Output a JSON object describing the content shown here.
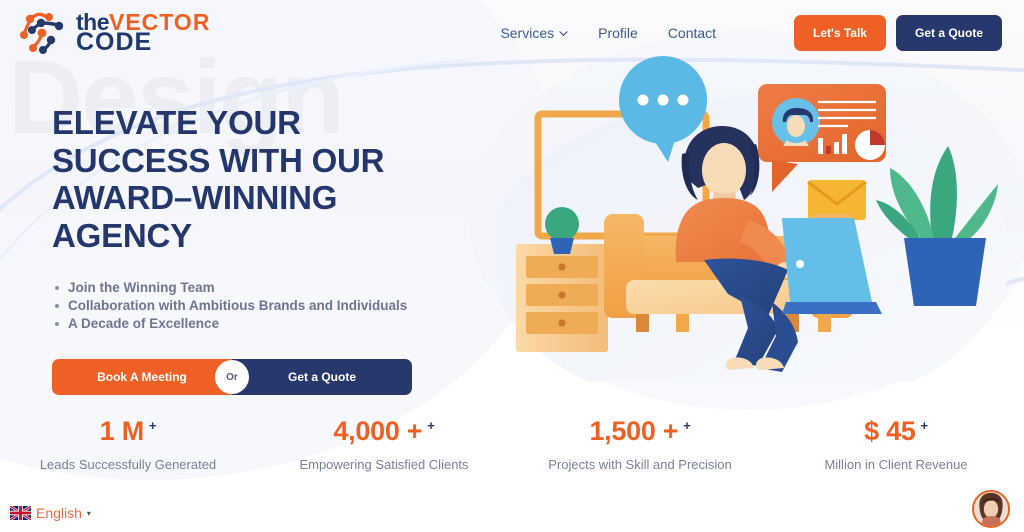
{
  "brand": {
    "logo_line1_the": "the",
    "logo_line1_vector": "VECTOR",
    "logo_line2": "CODE",
    "logo_icon": "network-nodes-logo",
    "color_orange": "#ef6024",
    "color_navy": "#27386d"
  },
  "nav": {
    "items": [
      {
        "label": "Services",
        "has_dropdown": true,
        "icon": "chevron-down-icon"
      },
      {
        "label": "Profile",
        "has_dropdown": false
      },
      {
        "label": "Contact",
        "has_dropdown": false
      }
    ],
    "cta_primary": "Let's Talk",
    "cta_secondary": "Get a Quote"
  },
  "hero": {
    "watermark": "Design",
    "headline_lines": [
      "ELEVATE YOUR",
      "SUCCESS WITH OUR",
      "AWARD–WINNING",
      "AGENCY"
    ],
    "bullets": [
      "Join the Winning Team",
      "Collaboration with Ambitious Brands and Individuals",
      "A Decade of Excellence"
    ],
    "cta_left": "Book A Meeting",
    "cta_divider": "Or",
    "cta_right": "Get a Quote",
    "illustration": "woman-on-sofa-with-laptop-illustration"
  },
  "stats": [
    {
      "number": "1 M",
      "sup": "+",
      "label": "Leads Successfully Generated"
    },
    {
      "number": "4,000 +",
      "sup": "+",
      "label": "Empowering Satisfied Clients"
    },
    {
      "number": "1,500 +",
      "sup": "+",
      "label": "Projects with Skill and Precision"
    },
    {
      "number": "$ 45",
      "sup": "+",
      "label": "Million in Client Revenue"
    }
  ],
  "language": {
    "flag": "uk-flag-icon",
    "label": "English",
    "caret": "▾"
  },
  "chat": {
    "avatar": "support-agent-avatar"
  }
}
